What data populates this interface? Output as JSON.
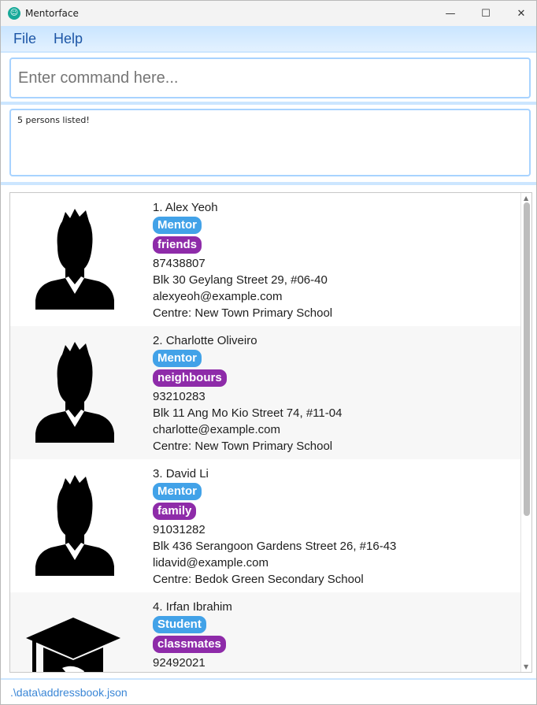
{
  "window": {
    "title": "Mentorface",
    "app_icon_glyph": "☺",
    "minimize_glyph": "—",
    "maximize_glyph": "☐",
    "close_glyph": "✕"
  },
  "menu": {
    "file": "File",
    "help": "Help"
  },
  "command": {
    "placeholder": "Enter command here..."
  },
  "result": {
    "text": "5 persons listed!"
  },
  "persons": [
    {
      "index": "1.",
      "name": "Alex Yeoh",
      "role": "Mentor",
      "group": "friends",
      "phone": "87438807",
      "address": "Blk 30 Geylang Street 29, #06-40",
      "email": "alexyeoh@example.com",
      "centre": "Centre: New Town Primary School",
      "avatar": "person-avatar-icon"
    },
    {
      "index": "2.",
      "name": "Charlotte Oliveiro",
      "role": "Mentor",
      "group": "neighbours",
      "phone": "93210283",
      "address": "Blk 11 Ang Mo Kio Street 74, #11-04",
      "email": "charlotte@example.com",
      "centre": "Centre: New Town Primary School",
      "avatar": "person-avatar-icon"
    },
    {
      "index": "3.",
      "name": "David Li",
      "role": "Mentor",
      "group": "family",
      "phone": "91031282",
      "address": "Blk 436 Serangoon Gardens Street 26, #16-43",
      "email": "lidavid@example.com",
      "centre": "Centre: Bedok Green Secondary School",
      "avatar": "person-avatar-icon"
    },
    {
      "index": "4.",
      "name": "Irfan Ibrahim",
      "role": "Student",
      "group": "classmates",
      "phone": "92492021",
      "avatar": "graduation-cap-icon"
    }
  ],
  "status": {
    "path": ".\\data\\addressbook.json"
  },
  "colors": {
    "menu_text": "#1d56a6",
    "role_tag": "#42a2e8",
    "group_tag": "#8e2ba9",
    "accent_border": "#a8d3ff",
    "status_text": "#3a86d6"
  }
}
